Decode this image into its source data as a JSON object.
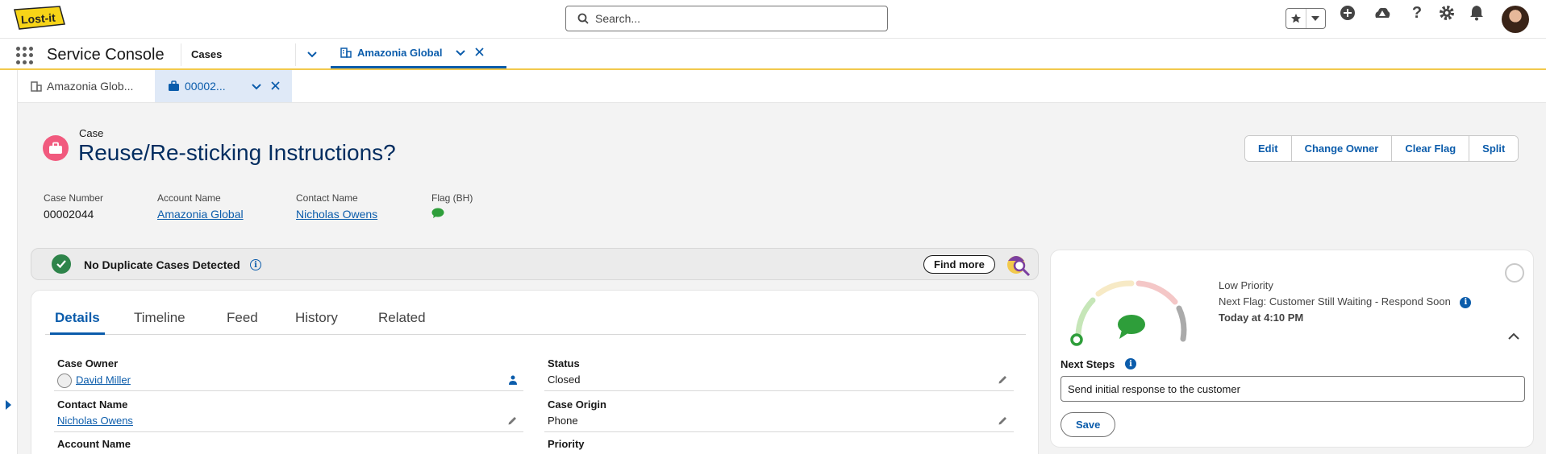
{
  "header": {
    "logo_text": "Lost-it",
    "search_placeholder": "Search..."
  },
  "nav": {
    "app_name": "Service Console",
    "object": "Cases",
    "open_tab": "Amazonia Global |..."
  },
  "subtabs": [
    {
      "label": "Amazonia Glob..."
    },
    {
      "label": "00002..."
    }
  ],
  "record": {
    "object_label": "Case",
    "title": "Reuse/Re-sticking Instructions?",
    "actions": [
      "Edit",
      "Change Owner",
      "Clear Flag",
      "Split"
    ],
    "highlights": [
      {
        "label": "Case Number",
        "value": "00002044"
      },
      {
        "label": "Account Name",
        "value": "Amazonia Global"
      },
      {
        "label": "Contact Name",
        "value": "Nicholas Owens"
      },
      {
        "label": "Flag (BH)",
        "value": ""
      }
    ]
  },
  "duplicates": {
    "message": "No Duplicate Cases Detected",
    "find_more": "Find more"
  },
  "details": {
    "tabs": [
      "Details",
      "Timeline",
      "Feed",
      "History",
      "Related"
    ],
    "fields_left": [
      {
        "label": "Case Owner",
        "value": "David Miller"
      },
      {
        "label": "Contact Name",
        "value": "Nicholas Owens"
      },
      {
        "label": "Account Name",
        "value": ""
      }
    ],
    "fields_right": [
      {
        "label": "Status",
        "value": "Closed"
      },
      {
        "label": "Case Origin",
        "value": "Phone"
      },
      {
        "label": "Priority",
        "value": ""
      }
    ]
  },
  "flag_panel": {
    "priority": "Low Priority",
    "next_flag": "Next Flag: Customer Still Waiting - Respond Soon",
    "when": "Today at 4:10 PM",
    "next_steps_label": "Next Steps",
    "next_steps_value": "Send initial response to the customer",
    "save": "Save"
  },
  "colors": {
    "brand": "#0b5cab",
    "case_icon": "#f15a7e",
    "success": "#2e844a",
    "flag_green": "#2e9e3a",
    "nav_accent": "#f2c94c"
  }
}
